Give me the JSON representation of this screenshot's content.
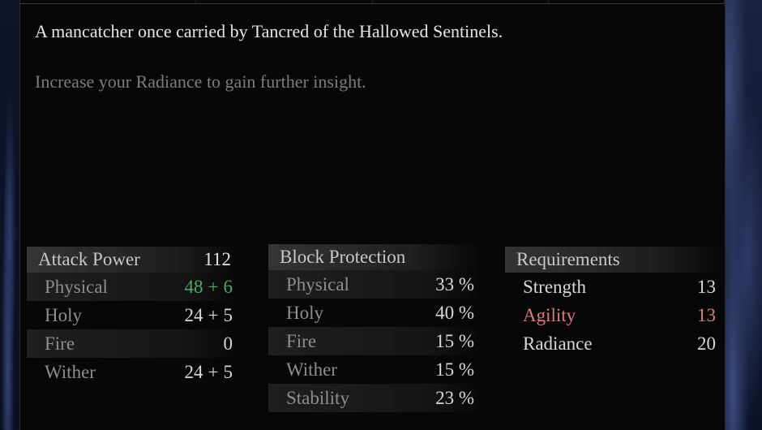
{
  "description": "A mancatcher once carried by Tancred of the Hallowed Sentinels.",
  "insight_hint": "Increase your Radiance to gain further insight.",
  "attack_power": {
    "title": "Attack Power",
    "total": "112",
    "rows": [
      {
        "label": "Physical",
        "base": "48",
        "bonus": "6",
        "highlight": "green"
      },
      {
        "label": "Holy",
        "base": "24",
        "bonus": "5"
      },
      {
        "label": "Fire",
        "base": "0",
        "bonus": ""
      },
      {
        "label": "Wither",
        "base": "24",
        "bonus": "5"
      }
    ]
  },
  "block_protection": {
    "title": "Block Protection",
    "rows": [
      {
        "label": "Physical",
        "value": "33 %"
      },
      {
        "label": "Holy",
        "value": "40 %"
      },
      {
        "label": "Fire",
        "value": "15 %"
      },
      {
        "label": "Wither",
        "value": "15 %"
      },
      {
        "label": "Stability",
        "value": "23 %"
      }
    ]
  },
  "requirements": {
    "title": "Requirements",
    "rows": [
      {
        "label": "Strength",
        "value": "13",
        "status": "met"
      },
      {
        "label": "Agility",
        "value": "13",
        "status": "unmet"
      },
      {
        "label": "Radiance",
        "value": "20",
        "status": "met"
      }
    ]
  },
  "colors": {
    "bonus_green": "#4aa868",
    "unmet_red": "#e07a7a"
  }
}
